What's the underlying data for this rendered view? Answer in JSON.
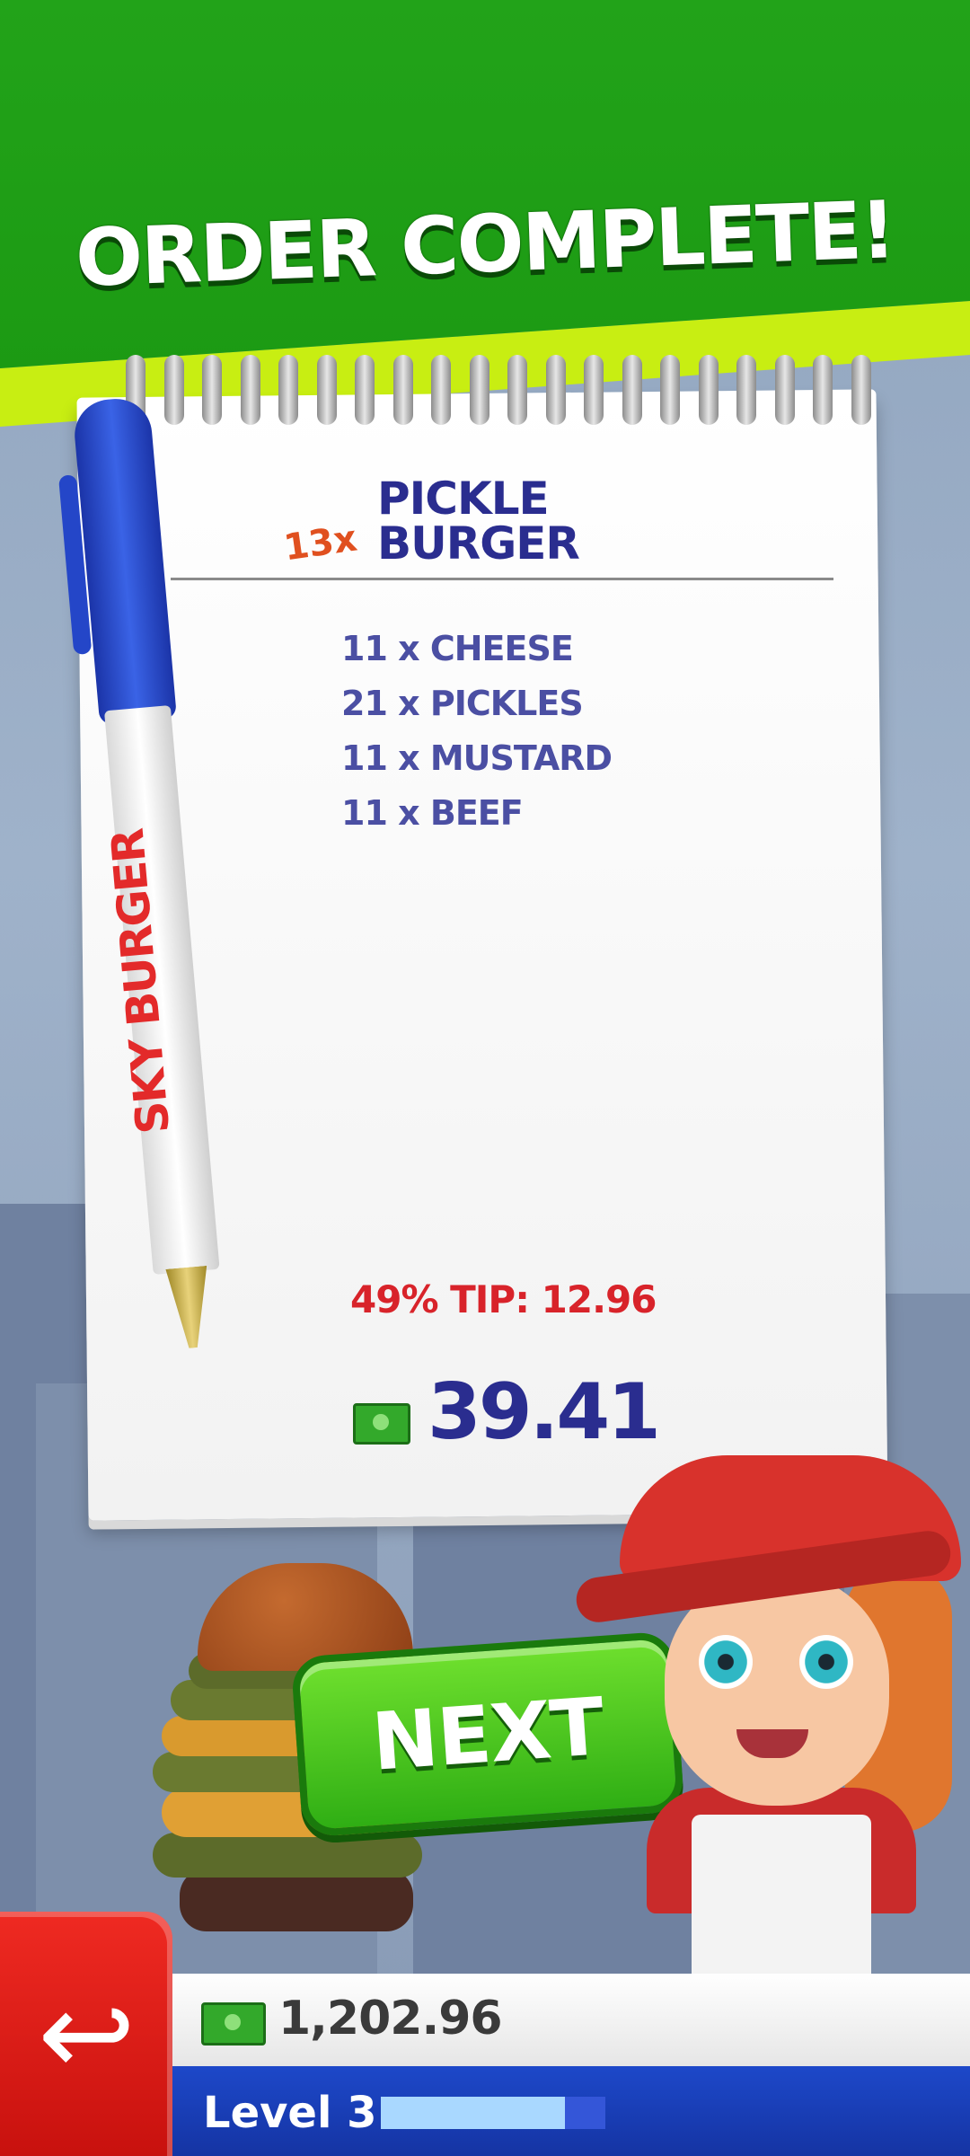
{
  "banner": {
    "title": "ORDER COMPLETE!"
  },
  "order": {
    "quantity": "13x",
    "burger_line1": "PICKLE",
    "burger_line2": "BURGER",
    "ingredients": [
      "11 x CHEESE",
      "21 x PICKLES",
      "11 x MUSTARD",
      "11 x BEEF"
    ],
    "tip": "49% TIP: 12.96",
    "total": "39.41"
  },
  "pen": {
    "brand": "SKY BURGER"
  },
  "next_button": {
    "label": "NEXT"
  },
  "footer": {
    "balance": "1,202.96",
    "level_label": "Level",
    "level_number": "3",
    "level_progress": 0.82
  },
  "colors": {
    "banner_green": "#1c9a13",
    "accent_lime": "#c8ee12",
    "ink_blue": "#2a2d8f",
    "tip_red": "#d8232a",
    "back_red": "#d8161a"
  },
  "icons": {
    "back": "back-arrow-icon",
    "cash": "cash-icon"
  }
}
